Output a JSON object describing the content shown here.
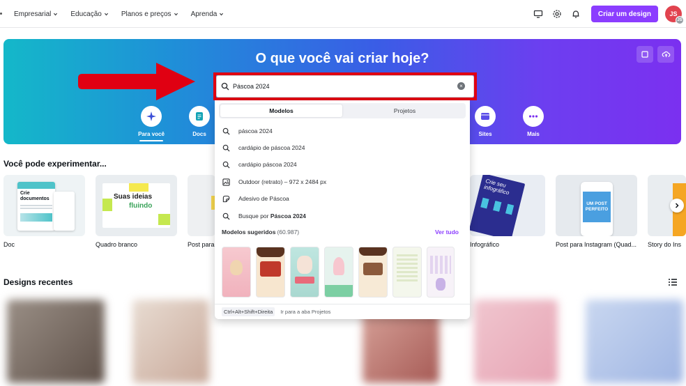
{
  "nav": {
    "items": [
      "Empresarial",
      "Educação",
      "Planos e preços",
      "Aprenda"
    ],
    "create_label": "Criar um design",
    "avatar_initials": "JS",
    "avatar_badge": "JS"
  },
  "hero": {
    "title": "O que você vai criar hoje?",
    "categories": [
      {
        "label": "Para você",
        "icon": "sparkle-icon"
      },
      {
        "label": "Docs",
        "icon": "doc-icon"
      },
      {
        "label": "Sites",
        "icon": "browser-icon"
      },
      {
        "label": "Mais",
        "icon": "more-dots-icon"
      }
    ]
  },
  "search": {
    "value": "Páscoa 2024",
    "tabs": [
      "Modelos",
      "Projetos"
    ],
    "suggestions": [
      {
        "text": "páscoa 2024",
        "icon": "search-icon"
      },
      {
        "text": "cardápio de páscoa 2024",
        "icon": "search-icon"
      },
      {
        "text": "cardápio páscoa 2024",
        "icon": "search-icon"
      },
      {
        "text": "Outdoor (retrato) – 972 x 2484 px",
        "icon": "image-icon"
      },
      {
        "text": "Adesivo de Páscoa",
        "icon": "sticker-icon"
      }
    ],
    "search_for_prefix": "Busque por",
    "search_for_term": "Páscoa 2024",
    "templates_title": "Modelos sugeridos",
    "templates_count": "(60.987)",
    "see_all": "Ver tudo",
    "footer_shortcut": "Ctrl+Alt+Shift+Direita",
    "footer_hint": "Ir para a aba Projetos"
  },
  "try_section": {
    "title": "Você pode experimentar...",
    "cards": [
      "Doc",
      "Quadro branco",
      "Post para",
      "Infográfico",
      "Post para Instagram (Quad...",
      "Story do Ins"
    ],
    "doc_thumb_text": "Crie documentos",
    "whiteboard_thumb_line1": "Suas ideias",
    "whiteboard_thumb_line2": "fluindo",
    "infographic_thumb_text": "Crie seu infográfico",
    "instagram_thumb_text": "UM POST PERFEITO"
  },
  "recent": {
    "title": "Designs recentes"
  },
  "colors": {
    "accent": "#8b3dff",
    "highlight_red": "#e00012"
  }
}
